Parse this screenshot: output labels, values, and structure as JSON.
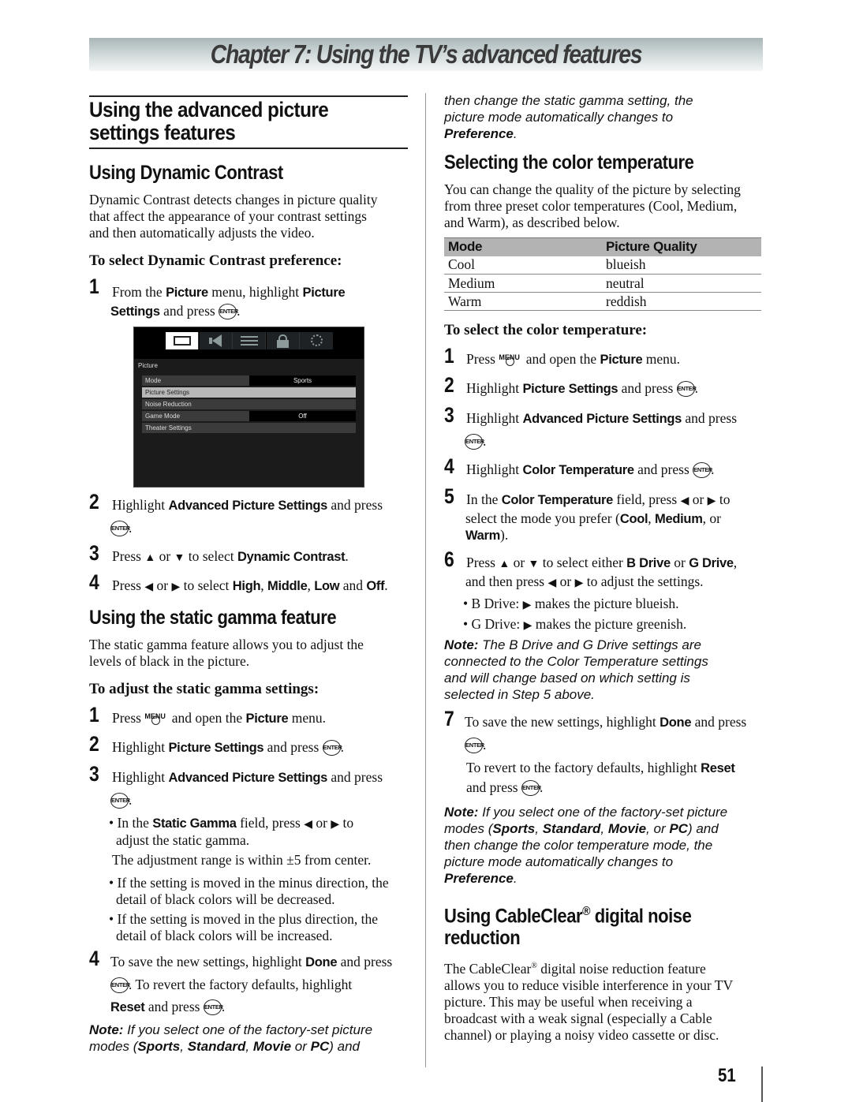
{
  "chapter_title": "Chapter 7: Using the TV’s advanced features",
  "left": {
    "section_title_line1": "Using the advanced picture",
    "section_title_line2": "settings features",
    "dynamic_contrast": {
      "heading": "Using Dynamic Contrast",
      "intro": [
        "Dynamic Contrast detects changes in picture quality",
        "that affect the appearance of your contrast settings",
        "and then automatically adjusts the video."
      ],
      "subhead": "To select Dynamic Contrast preference:",
      "step1": {
        "num": "1",
        "a": "From the ",
        "b1": "Picture",
        "c": " menu, highlight ",
        "b2": "Picture",
        "b3": "Settings",
        "d": " and press ",
        "e": "."
      },
      "step2": {
        "num": "2",
        "a": "Highlight ",
        "b1": "Advanced Picture Settings",
        "c": " and press",
        "e": "."
      },
      "step3": {
        "num": "3",
        "a": "Press ",
        "up": "▲",
        "or": " or ",
        "down": "▼",
        "c": " to select ",
        "b1": "Dynamic Contrast",
        "e": "."
      },
      "step4": {
        "num": "4",
        "a": "Press ",
        "left": "◀",
        "or": " or ",
        "right": "▶",
        "c": " to select ",
        "b1": "High",
        "s1": ", ",
        "b2": "Middle",
        "s2": ", ",
        "b3": "Low",
        "s3": " and ",
        "b4": "Off",
        "e": "."
      }
    },
    "tv_menu": {
      "tabs": [
        "picture-icon",
        "sound-icon",
        "settings-sliders-icon",
        "lock-icon",
        "gear-icon"
      ],
      "active_tab": 0,
      "section": "Picture",
      "rows": [
        {
          "label": "Mode",
          "value": "Sports"
        },
        {
          "label": "Picture Settings",
          "value": null,
          "highlighted": true
        },
        {
          "label": "Noise Reduction",
          "value": null
        },
        {
          "label": "Game Mode",
          "value": "Off"
        },
        {
          "label": "Theater Settings",
          "value": null
        }
      ]
    },
    "static_gamma": {
      "heading": "Using the static gamma feature",
      "intro": [
        "The static gamma feature allows you to adjust the",
        "levels of black in the picture."
      ],
      "subhead": "To adjust the static gamma settings:",
      "step1": {
        "num": "1",
        "a": "Press ",
        "menu": "MENU",
        "c": " and open the ",
        "b1": "Picture",
        "e": " menu."
      },
      "step2": {
        "num": "2",
        "a": "Highlight ",
        "b1": "Picture Settings",
        "c": " and press ",
        "e": "."
      },
      "step3": {
        "num": "3",
        "a": "Highlight ",
        "b1": "Advanced Picture Settings",
        "c": " and press",
        "e": "."
      },
      "bullet1": {
        "a": "In the ",
        "b1": "Static Gamma",
        "c": " field, press ",
        "left": "◀",
        "or": " or ",
        "right": "▶",
        "d": " to",
        "line2": "adjust the static gamma."
      },
      "range_note": "The adjustment range is within ±5 from center.",
      "bullet2": [
        "If the setting is moved in the minus direction, the",
        "detail of black colors will be decreased."
      ],
      "bullet3": [
        "If the setting is moved in the plus direction, the",
        "detail of black colors will be increased."
      ],
      "step4": {
        "num": "4",
        "a": "To save the new settings, highlight ",
        "b1": "Done",
        "c": " and press",
        "d": ". To revert the factory defaults, highlight",
        "b2": "Reset",
        "f": " and press ",
        "e": "."
      },
      "note": {
        "label": "Note:",
        "a": " If you select one of the factory-set picture",
        "b": "modes (",
        "m1": "Sports",
        "s1": ", ",
        "m2": "Standard",
        "s2": ", ",
        "m3": "Movie",
        "s3": " or ",
        "m4": "PC",
        "c": ") and"
      }
    }
  },
  "right": {
    "note_cont": {
      "line1": "then change the static gamma setting, the",
      "line2": "picture mode automatically changes to",
      "pref": "Preference",
      "dot": "."
    },
    "color_temp": {
      "heading": "Selecting the color temperature",
      "intro": [
        "You can change the quality of the picture by selecting",
        "from three preset color temperatures (Cool, Medium,",
        "and Warm), as described below."
      ],
      "table": {
        "headers": [
          "Mode",
          "Picture Quality"
        ],
        "rows": [
          [
            "Cool",
            "blueish"
          ],
          [
            "Medium",
            "neutral"
          ],
          [
            "Warm",
            "reddish"
          ]
        ]
      },
      "subhead": "To select the color temperature:",
      "step1": {
        "num": "1",
        "a": "Press ",
        "menu": "MENU",
        "c": " and open the ",
        "b1": "Picture",
        "e": " menu."
      },
      "step2": {
        "num": "2",
        "a": "Highlight ",
        "b1": "Picture Settings",
        "c": " and press ",
        "e": "."
      },
      "step3": {
        "num": "3",
        "a": "Highlight ",
        "b1": "Advanced Picture Settings",
        "c": " and press",
        "e": "."
      },
      "step4": {
        "num": "4",
        "a": "Highlight ",
        "b1": "Color Temperature",
        "c": " and press ",
        "e": "."
      },
      "step5": {
        "num": "5",
        "a": "In the ",
        "b1": "Color Temperature",
        "c": " field, press ",
        "left": "◀",
        "or": " or ",
        "right": "▶",
        "d": " to",
        "line2a": "select the mode you prefer (",
        "m1": "Cool",
        "s1": ", ",
        "m2": "Medium",
        "s2": ", or",
        "m3": "Warm",
        "e": ")."
      },
      "step6": {
        "num": "6",
        "a": "Press ",
        "up": "▲",
        "or": " or ",
        "down": "▼",
        "c": " to select either ",
        "b1": "B Drive",
        "or2": " or ",
        "b2": "G Drive",
        "s": ",",
        "line2a": "and then press ",
        "left": "◀",
        "right": "▶",
        "line2b": " to adjust the settings."
      },
      "bullet_b": {
        "a": "B Drive: ",
        "arrow": "▶",
        "b": " makes the picture blueish."
      },
      "bullet_g": {
        "a": "G Drive: ",
        "arrow": "▶",
        "b": " makes the picture greenish."
      },
      "note1": {
        "label": "Note:",
        "lines": [
          " The B Drive and G Drive settings are",
          "connected to the Color Temperature settings",
          "and will change based on which setting is",
          "selected in Step 5 above."
        ]
      },
      "step7": {
        "num": "7",
        "a": "To save the new settings, highlight ",
        "b1": "Done",
        "c": " and press",
        "e": ".",
        "revert_a": "To revert to the factory defaults, highlight ",
        "b2": "Reset",
        "revert_b": "and press ",
        "e2": "."
      },
      "note2": {
        "label": "Note:",
        "a": " If you select one of the factory-set picture",
        "b": "modes (",
        "m1": "Sports",
        "s1": ", ",
        "m2": "Standard",
        "s2": ", ",
        "m3": "Movie",
        "s3": ", or ",
        "m4": "PC",
        "c": ") and",
        "line3": "then change the color temperature mode, the",
        "line4": "picture mode automatically changes to",
        "pref": "Preference",
        "dot": "."
      }
    },
    "cableclear": {
      "heading_a": "Using CableClear",
      "reg": "®",
      "heading_b": " digital noise",
      "heading_line2": "reduction",
      "body_a": "The CableClear",
      "body_lines": [
        " digital noise reduction feature",
        "allows you to reduce visible interference in your TV",
        "picture. This may be useful when receiving a",
        "broadcast with a weak signal (especially a Cable",
        "channel) or playing a noisy video cassette or disc."
      ]
    }
  },
  "enter_label": "ENTER",
  "page_number": "51"
}
